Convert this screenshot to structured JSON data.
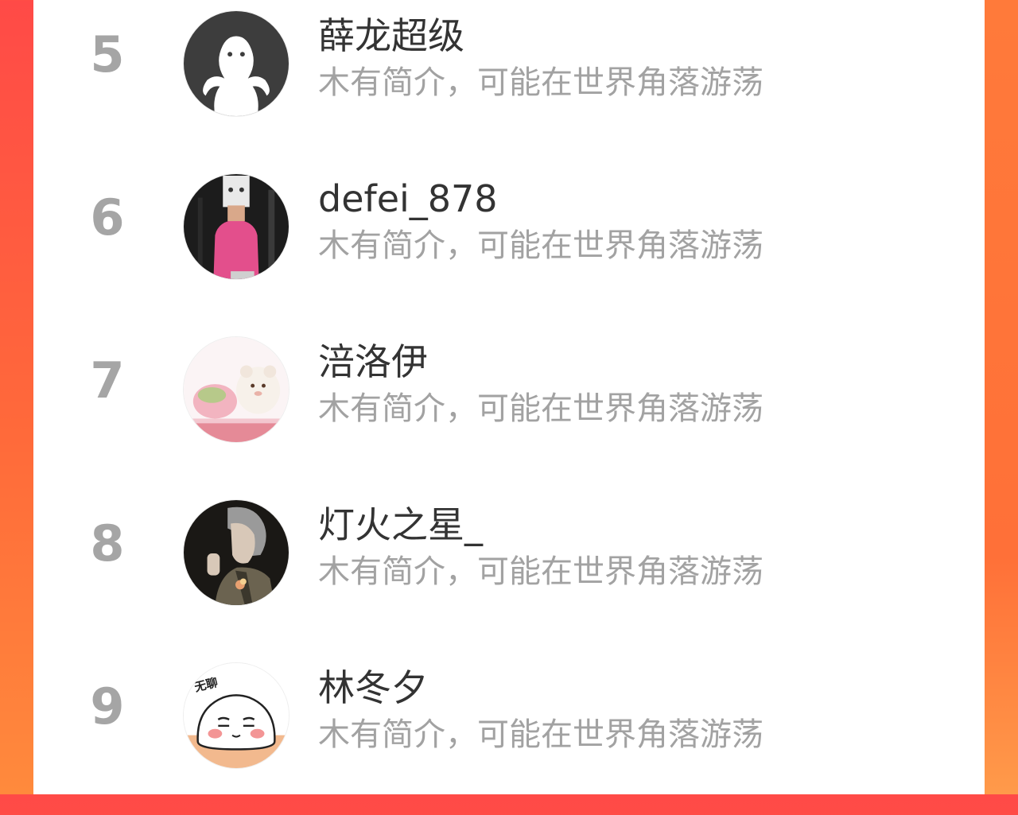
{
  "rows": [
    {
      "rank": "5",
      "name": "薛龙超级",
      "intro": "木有简介，可能在世界角落游荡",
      "avatar_icon": "ghost-avatar-icon"
    },
    {
      "rank": "6",
      "name": "defei_878",
      "intro": "木有简介，可能在世界角落游荡",
      "avatar_icon": "pink-shirt-photo-avatar"
    },
    {
      "rank": "7",
      "name": "涪洛伊",
      "intro": "木有简介，可能在世界角落游荡",
      "avatar_icon": "plush-toys-photo-avatar"
    },
    {
      "rank": "8",
      "name": "灯火之星_",
      "intro": "木有简介，可能在世界角落游荡",
      "avatar_icon": "anime-man-photo-avatar"
    },
    {
      "rank": "9",
      "name": "林冬夕",
      "intro": "木有简介，可能在世界角落游荡",
      "avatar_icon": "blushing-face-avatar",
      "avatar_text": "无聊"
    }
  ],
  "colors": {
    "background_left": "#ff4a47",
    "background_right": "#ff7a3a",
    "panel": "#ffffff",
    "rank_text": "#a5a5a5",
    "name_text": "#333333",
    "intro_text": "#a2a2a2"
  }
}
